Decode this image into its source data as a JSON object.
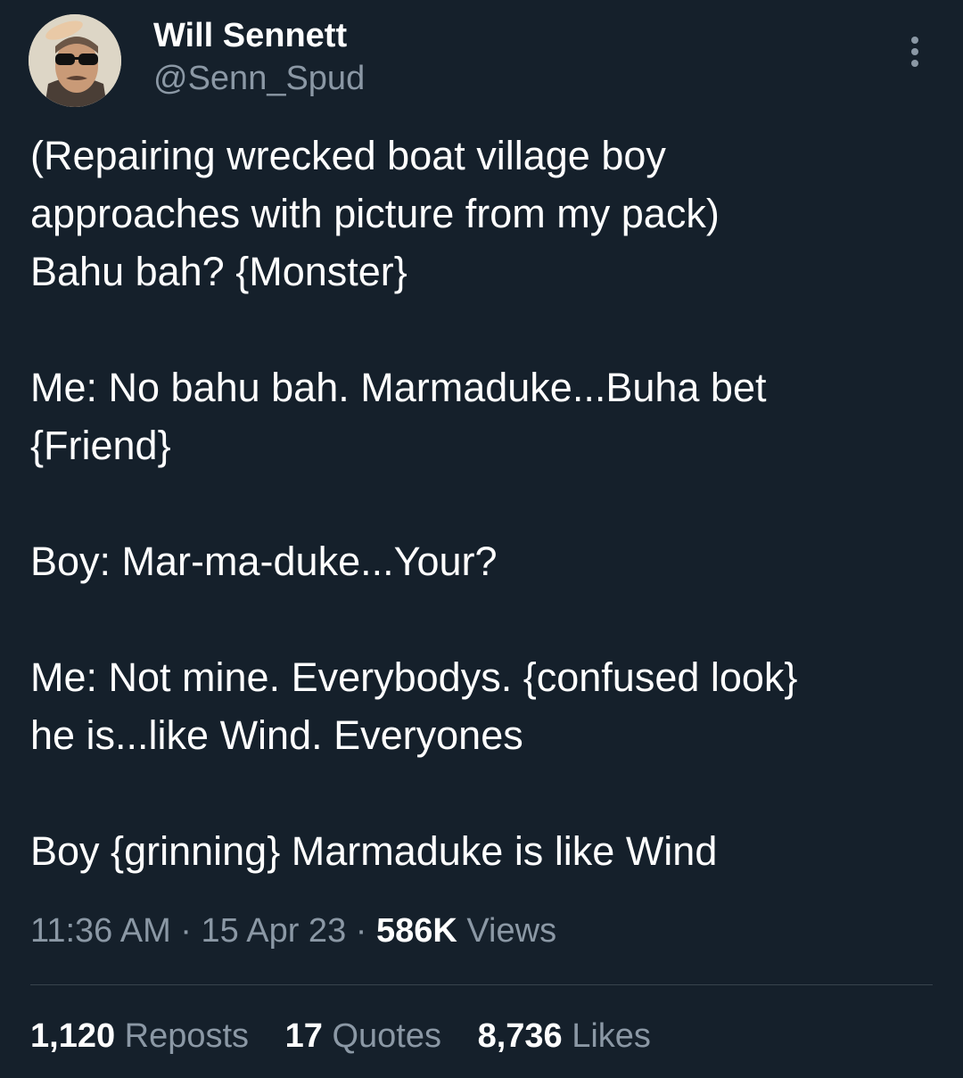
{
  "author": {
    "name": "Will Sennett",
    "handle": "@Senn_Spud"
  },
  "icons": {
    "more": "more-vertical-icon",
    "avatar": "profile-photo"
  },
  "tweet": {
    "lines": [
      "(Repairing wrecked boat village boy",
      "approaches with picture from my pack)",
      "Bahu bah? {Monster}",
      "",
      "Me: No bahu bah. Marmaduke...Buha bet",
      "{Friend}",
      "",
      "Boy: Mar-ma-duke...Your?",
      "",
      "Me: Not mine. Everybodys. {confused look}",
      "he is...like Wind. Everyones",
      "",
      "Boy {grinning} Marmaduke is like Wind"
    ]
  },
  "meta": {
    "time": "11:36 AM",
    "separator": "·",
    "date": "15 Apr 23",
    "views_count": "586K",
    "views_label": "Views"
  },
  "stats": {
    "reposts_count": "1,120",
    "reposts_label": "Reposts",
    "quotes_count": "17",
    "quotes_label": "Quotes",
    "likes_count": "8,736",
    "likes_label": "Likes"
  },
  "colors": {
    "background": "#15202b",
    "primary_text": "#ffffff",
    "secondary_text": "#8b98a5",
    "divider": "#38444d"
  }
}
